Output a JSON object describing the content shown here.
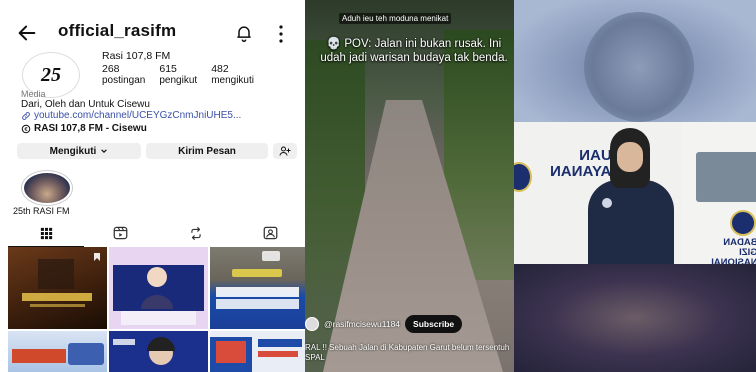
{
  "ig": {
    "username": "official_rasifm",
    "name": "Rasi 107,8 FM",
    "avatar_logo": "25",
    "stats": [
      {
        "num": "268",
        "label": "postingan"
      },
      {
        "num": "615",
        "label": "pengikut"
      },
      {
        "num": "482",
        "label": "mengikuti"
      }
    ],
    "category": "Media",
    "bio": "Dari, Oleh dan Untuk Cisewu",
    "link": "youtube.com/channel/UCEYGzCnmJniUHE5...",
    "external": "RASI 107,8 FM - Cisewu",
    "follow_button": "Mengikuti",
    "message_button": "Kirim Pesan",
    "highlight_label": "25th RASI FM",
    "icons": {
      "back": "back-arrow-icon",
      "bell": "bell-icon",
      "more": "more-vertical-icon",
      "link": "link-icon",
      "external": "threads-icon",
      "add_user": "add-person-icon",
      "tab_grid": "grid-icon",
      "tab_reels": "reels-icon",
      "tab_repost": "repost-icon",
      "tab_tagged": "tagged-icon"
    }
  },
  "video": {
    "top_text": "Aduh ieu teh moduna menikat",
    "caption": "💀 POV: Jalan ini bukan rusak. Ini udah jadi warisan budaya tak benda.",
    "channel": "@rasifmcisewu1184",
    "subscribe": "Subscribe",
    "desc_line1": "RAL !! Sebuah Jalan di Kabupaten Garut belum tersentuh",
    "desc_line2": "SPAL"
  },
  "right": {
    "truck_text": "SATUAN\nPELAYANAN\nHAN",
    "cab_text": "BADAN GIZI\nNASIONAL"
  }
}
